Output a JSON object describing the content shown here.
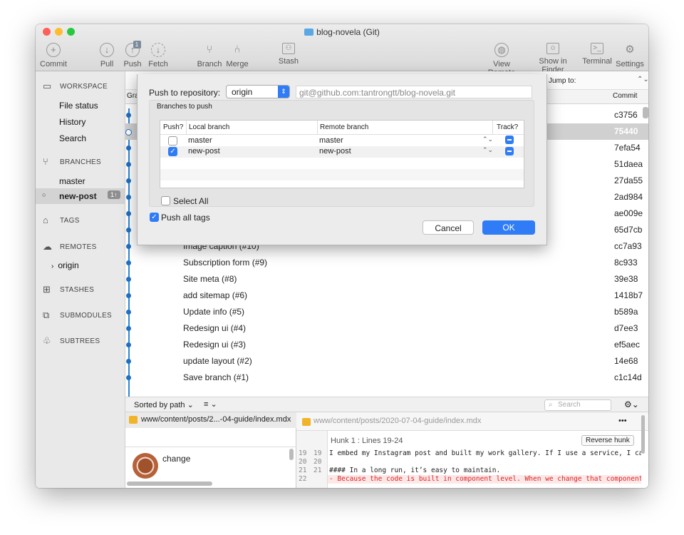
{
  "window": {
    "title": "blog-novela (Git)"
  },
  "toolbar": {
    "commit": "Commit",
    "pull": "Pull",
    "push": "Push",
    "push_badge": "1",
    "fetch": "Fetch",
    "branch": "Branch",
    "merge": "Merge",
    "stash": "Stash",
    "view_remote": "View Remote",
    "show_in_finder": "Show in Finder",
    "terminal": "Terminal",
    "settings": "Settings"
  },
  "sidebar": {
    "workspace": "WORKSPACE",
    "file_status": "File status",
    "history": "History",
    "search": "Search",
    "branches": "BRANCHES",
    "branch_master": "master",
    "branch_current": "new-post",
    "ahead_badge": "1↑",
    "tags": "TAGS",
    "remotes": "REMOTES",
    "remote_origin": "origin",
    "stashes": "STASHES",
    "submodules": "SUBMODULES",
    "subtrees": "SUBTREES"
  },
  "history": {
    "col_graph": "Gra",
    "jump_to": "Jump to:",
    "col_commit": "Commit",
    "rows": [
      {
        "msg": "",
        "hash": "c3756"
      },
      {
        "msg": "",
        "hash": "75440"
      },
      {
        "msg": "",
        "hash": "7efa54"
      },
      {
        "msg": "",
        "hash": "51daea"
      },
      {
        "msg": "",
        "hash": "27da55"
      },
      {
        "msg": "",
        "hash": "2ad984"
      },
      {
        "msg": "",
        "hash": "ae009e"
      },
      {
        "msg": "",
        "hash": "65d7cb"
      },
      {
        "msg": "Image caption (#10)",
        "hash": "cc7a93"
      },
      {
        "msg": "Subscription form (#9)",
        "hash": "8c933"
      },
      {
        "msg": "Site meta (#8)",
        "hash": "39e38"
      },
      {
        "msg": "add sitemap (#6)",
        "hash": "1418b7"
      },
      {
        "msg": "Update info (#5)",
        "hash": "b589a"
      },
      {
        "msg": "Redesign ui (#4)",
        "hash": "d7ee3"
      },
      {
        "msg": "Redesign ui (#3)",
        "hash": "ef5aec"
      },
      {
        "msg": "update layout (#2)",
        "hash": "14e68"
      },
      {
        "msg": "Save branch (#1)",
        "hash": "c1c14d"
      }
    ]
  },
  "bottom": {
    "sort": "Sorted by path ⌄",
    "list_icon": "≡ ⌄",
    "search_placeholder": "Search"
  },
  "files": {
    "file": "www/content/posts/2...-04-guide/index.mdx",
    "commit_msg": "change"
  },
  "diff": {
    "path": "www/content/posts/2020-07-04-guide/index.mdx",
    "more": "•••",
    "hunk": "Hunk 1 : Lines 19-24",
    "reverse": "Reverse hunk",
    "lines": [
      {
        "a": "19",
        "b": "19",
        "text": "  I embed my Instagram post and built my work gallery. If I use a service, I can't",
        "type": "ctx"
      },
      {
        "a": "20",
        "b": "20",
        "text": "",
        "type": "ctx"
      },
      {
        "a": "21",
        "b": "21",
        "text": "  #### In a long run, it’s easy to maintain.",
        "type": "ctx"
      },
      {
        "a": "22",
        "b": "",
        "text": "- Because the code is built in component level. When we change that component, eve",
        "type": "del"
      }
    ]
  },
  "dialog": {
    "push_to": "Push to repository:",
    "repo": "origin",
    "url": "git@github.com:tantrongtt/blog-novela.git",
    "branches_label": "Branches to push",
    "col_push": "Push?",
    "col_local": "Local branch",
    "col_remote": "Remote branch",
    "col_track": "Track?",
    "branches": [
      {
        "local": "master",
        "remote": "master",
        "push": false,
        "track": true
      },
      {
        "local": "new-post",
        "remote": "new-post",
        "push": true,
        "track": true
      }
    ],
    "select_all": "Select All",
    "push_all_tags": "Push all tags",
    "cancel": "Cancel",
    "ok": "OK"
  },
  "colors": {
    "accent": "#2f7cf6",
    "graph": "#1f6fc2",
    "deletion": "#d22"
  }
}
